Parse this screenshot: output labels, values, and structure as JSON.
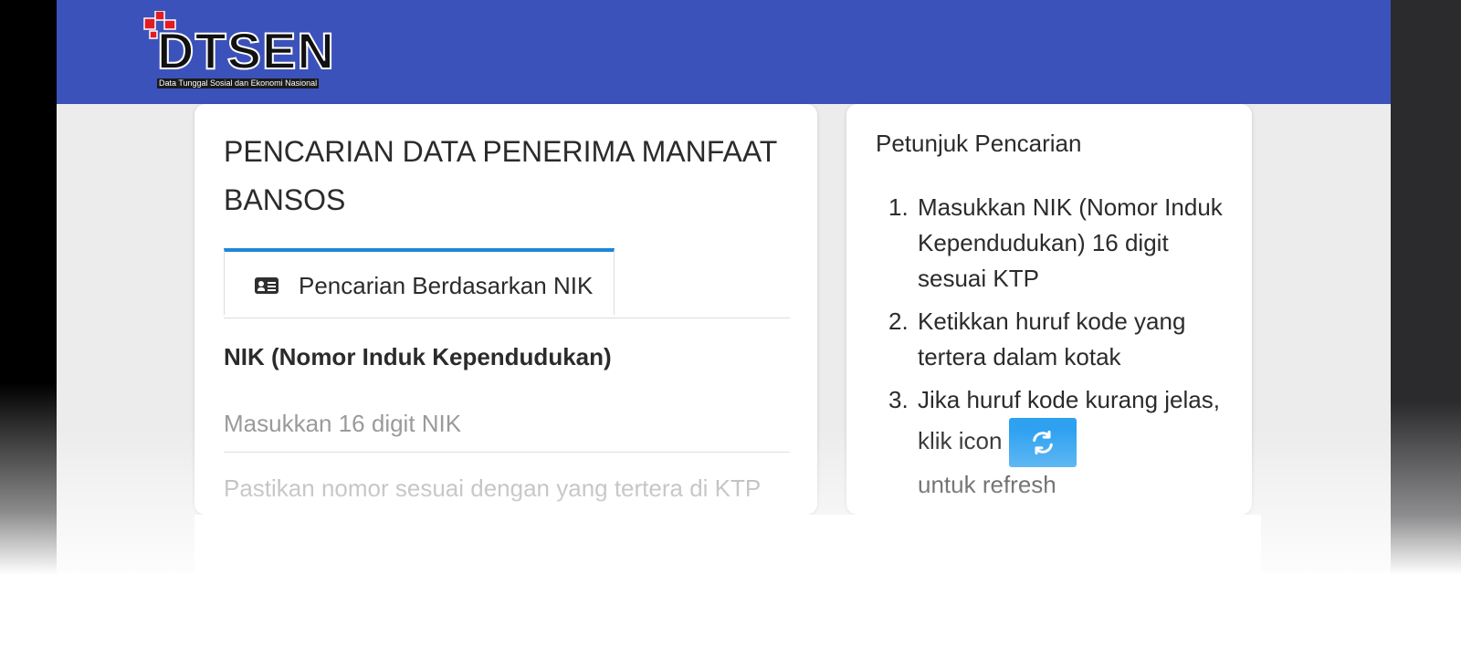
{
  "brand": {
    "logo_text": "DTSEN",
    "logo_subtitle": "Data Tunggal Sosial dan Ekonomi Nasional",
    "header_color": "#3c52bb"
  },
  "search_card": {
    "title": "PENCARIAN DATA PENERIMA MANFAAT BANSOS",
    "tab": {
      "icon": "id-card-icon",
      "label": "Pencarian Berdasarkan NIK",
      "accent_color": "#1f87d6"
    },
    "nik_field": {
      "label": "NIK (Nomor Induk Kependudukan)",
      "value": "",
      "placeholder": "Masukkan 16 digit NIK",
      "hint": "Pastikan nomor sesuai dengan yang tertera di KTP"
    }
  },
  "guide_card": {
    "title": "Petunjuk Pencarian",
    "steps": [
      {
        "number": "1.",
        "text": "Masukkan NIK (Nomor Induk Kependudukan) 16 digit sesuai KTP"
      },
      {
        "number": "2.",
        "text": "Ketikkan huruf kode yang tertera dalam kotak"
      },
      {
        "number": "3.",
        "text_before": "Jika huruf kode kurang jelas, klik icon",
        "text_after": "untuk refresh",
        "icon": "refresh-icon",
        "icon_color": "#2ea1f0"
      }
    ]
  }
}
